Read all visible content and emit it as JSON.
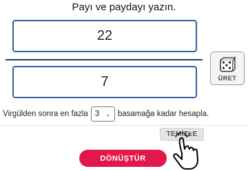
{
  "instruction": "Payı ve paydayı yazın.",
  "fraction": {
    "numerator": "22",
    "denominator": "7"
  },
  "generate_button": {
    "label": "ÜRET",
    "icon": "dice-icon"
  },
  "precision": {
    "text_before": "Virgülden sonra en fazla",
    "selected": "3",
    "text_after": "basamağa kadar hesapla."
  },
  "clear_button": {
    "label": "TEMİZLE"
  },
  "convert_button": {
    "label": "DÖNÜŞTÜR"
  },
  "colors": {
    "input_border": "#2e5fa3",
    "fraction_line": "#1d3b6b",
    "convert_button": "#e0194a"
  }
}
